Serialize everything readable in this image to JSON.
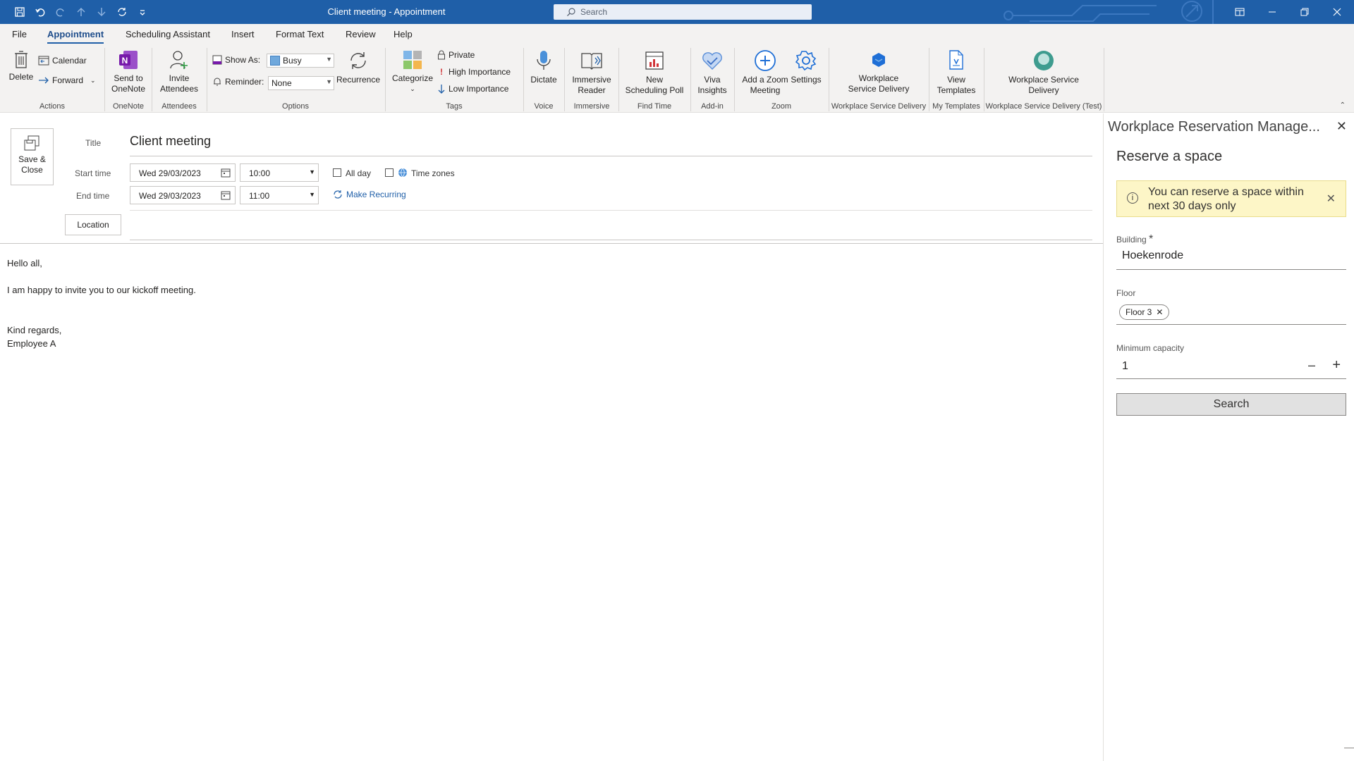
{
  "window": {
    "title": "Client meeting  -  Appointment",
    "search_placeholder": "Search"
  },
  "menu": {
    "tabs": [
      "File",
      "Appointment",
      "Scheduling Assistant",
      "Insert",
      "Format Text",
      "Review",
      "Help"
    ],
    "active": "Appointment"
  },
  "ribbon": {
    "delete": "Delete",
    "calendar": "Calendar",
    "forward": "Forward",
    "send_to_onenote_1": "Send to",
    "send_to_onenote_2": "OneNote",
    "invite_1": "Invite",
    "invite_2": "Attendees",
    "show_as_label": "Show As:",
    "show_as_value": "Busy",
    "reminder_label": "Reminder:",
    "reminder_value": "None",
    "recurrence": "Recurrence",
    "categorize": "Categorize",
    "private": "Private",
    "high_importance": "High Importance",
    "low_importance": "Low Importance",
    "dictate": "Dictate",
    "immersive_1": "Immersive",
    "immersive_2": "Reader",
    "new_poll_1": "New",
    "new_poll_2": "Scheduling Poll",
    "viva_1": "Viva",
    "viva_2": "Insights",
    "zoom_1": "Add a Zoom",
    "zoom_2": "Meeting",
    "settings": "Settings",
    "wsd_1": "Workplace",
    "wsd_2": "Service Delivery",
    "templates_1": "View",
    "templates_2": "Templates",
    "wsd_test_1": "Workplace Service",
    "wsd_test_2": "Delivery",
    "groups": {
      "actions": "Actions",
      "onenote": "OneNote",
      "attendees": "Attendees",
      "options": "Options",
      "tags": "Tags",
      "voice": "Voice",
      "immersive": "Immersive",
      "find_time": "Find Time",
      "addin": "Add-in",
      "zoom": "Zoom",
      "wsd": "Workplace Service Delivery",
      "my_templates": "My Templates",
      "wsd_test": "Workplace Service Delivery (Test)"
    }
  },
  "form": {
    "save_close_1": "Save &",
    "save_close_2": "Close",
    "title_label": "Title",
    "title_value": "Client meeting",
    "start_label": "Start time",
    "start_date": "Wed 29/03/2023",
    "start_time": "10:00",
    "end_label": "End time",
    "end_date": "Wed 29/03/2023",
    "end_time": "11:00",
    "all_day": "All day",
    "time_zones": "Time zones",
    "make_recurring": "Make Recurring",
    "location_button": "Location"
  },
  "body": {
    "lines": [
      "Hello all,",
      "",
      "I am happy to invite you to our kickoff meeting.",
      "",
      "",
      "Kind regards,",
      "Employee A"
    ]
  },
  "pane": {
    "title": "Workplace Reservation Manage...",
    "heading": "Reserve a space",
    "alert": "You can reserve a space within next 30 days only",
    "building_label": "Building",
    "building_value": "Hoekenrode",
    "floor_label": "Floor",
    "floor_chip": "Floor 3",
    "capacity_label": "Minimum capacity",
    "capacity_value": "1",
    "search_button": "Search"
  },
  "colors": {
    "titlebar": "#1f5fa8",
    "accent": "#1f5fa8",
    "alert_bg": "#fdf6c7"
  }
}
